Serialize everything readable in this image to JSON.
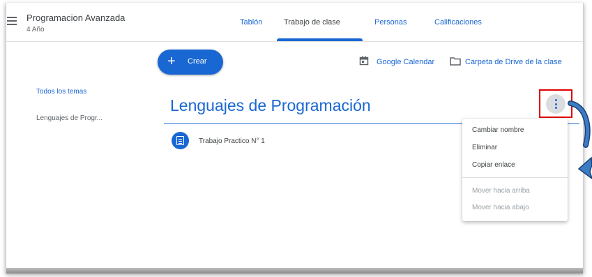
{
  "header": {
    "course_title": "Programacion Avanzada",
    "course_subtitle": "4 Año",
    "tabs": [
      {
        "label": "Tablón",
        "active": false
      },
      {
        "label": "Trabajo de clase",
        "active": true
      },
      {
        "label": "Personas",
        "active": false
      },
      {
        "label": "Calificaciones",
        "active": false
      }
    ]
  },
  "toolbar": {
    "create_label": "Crear",
    "google_calendar_label": "Google Calendar",
    "drive_folder_label": "Carpeta de Drive de la clase"
  },
  "sidebar": {
    "items": [
      {
        "label": "Todos los temas"
      },
      {
        "label": "Lenguajes de Progr..."
      }
    ]
  },
  "topic": {
    "title": "Lenguajes de Programación",
    "items": [
      {
        "label": "Trabajo Practico N° 1"
      }
    ]
  },
  "topic_menu": {
    "items": [
      {
        "label": "Cambiar nombre",
        "enabled": true
      },
      {
        "label": "Eliminar",
        "enabled": true
      },
      {
        "label": "Copiar enlace",
        "enabled": true
      },
      {
        "label": "Mover hacia arriba",
        "enabled": false
      },
      {
        "label": "Mover hacia abajo",
        "enabled": false
      }
    ]
  },
  "colors": {
    "accent": "#1967d2",
    "highlight": "#e00000",
    "annotation_arrow": "#3d7bc4"
  }
}
